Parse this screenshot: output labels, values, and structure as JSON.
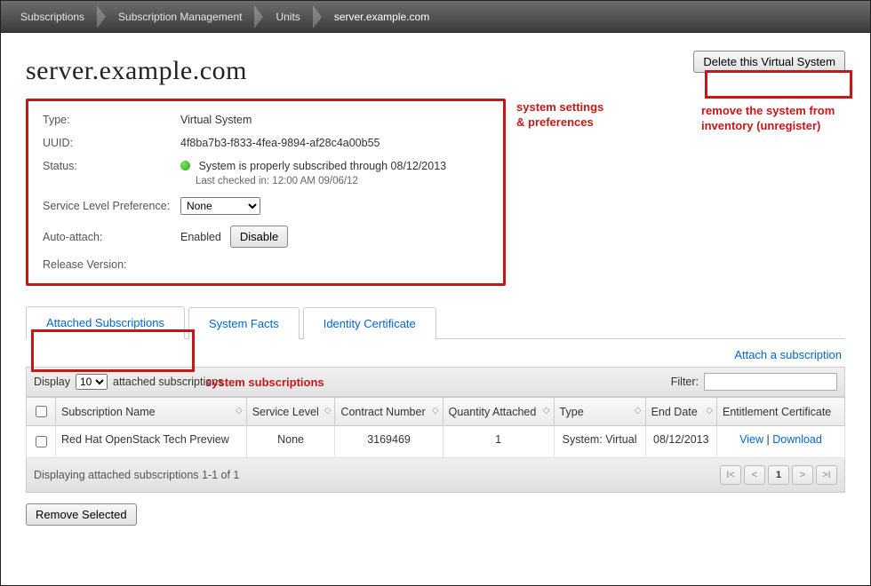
{
  "breadcrumbs": [
    "Subscriptions",
    "Subscription Management",
    "Units",
    "server.example.com"
  ],
  "page_title": "server.example.com",
  "delete_button": "Delete this Virtual System",
  "annot_settings": "system settings\n& preferences",
  "annot_delete": "remove the system from\ninventory (unregister)",
  "annot_subs": "system subscriptions",
  "settings": {
    "type_label": "Type:",
    "type_value": "Virtual System",
    "uuid_label": "UUID:",
    "uuid_value": "4f8ba7b3-f833-4fea-9894-af28c4a00b55",
    "status_label": "Status:",
    "status_value": "System is properly subscribed through 08/12/2013",
    "status_checked": "Last checked in: 12:00 AM 09/06/12",
    "svc_label": "Service Level Preference:",
    "svc_value": "None",
    "autoattach_label": "Auto-attach:",
    "autoattach_value": "Enabled",
    "autoattach_button": "Disable",
    "release_label": "Release Version:"
  },
  "tabs": {
    "attached": "Attached Subscriptions",
    "facts": "System Facts",
    "identity": "Identity Certificate"
  },
  "attach_link": "Attach a subscription",
  "list": {
    "display_prefix": "Display",
    "display_count": "10",
    "display_suffix": "attached subscriptions",
    "filter_label": "Filter:",
    "cols": {
      "name": "Subscription Name",
      "svc": "Service Level",
      "contract": "Contract Number",
      "qty": "Quantity Attached",
      "type": "Type",
      "end": "End Date",
      "cert": "Entitlement Certificate"
    },
    "row": {
      "name": "Red Hat OpenStack Tech Preview",
      "svc": "None",
      "contract": "3169469",
      "qty": "1",
      "type": "System: Virtual",
      "end": "08/12/2013",
      "view": "View",
      "download": "Download"
    },
    "pager_text": "Displaying attached subscriptions 1-1 of 1",
    "page_current": "1"
  },
  "remove_button": "Remove Selected"
}
